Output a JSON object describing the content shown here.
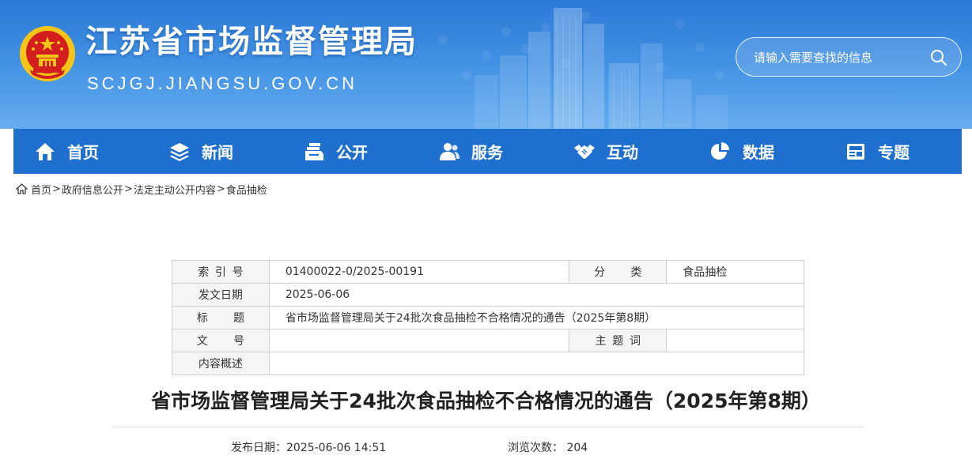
{
  "header": {
    "title": "江苏省市场监督管理局",
    "domain": "SCJGJ.JIANGSU.GOV.CN",
    "search_placeholder": "请输入需要查找的信息"
  },
  "nav": {
    "items": [
      {
        "label": "首页",
        "icon": "home-icon"
      },
      {
        "label": "新闻",
        "icon": "layers-icon"
      },
      {
        "label": "公开",
        "icon": "documents-icon"
      },
      {
        "label": "服务",
        "icon": "users-icon"
      },
      {
        "label": "互动",
        "icon": "handshake-icon"
      },
      {
        "label": "数据",
        "icon": "pie-chart-icon"
      },
      {
        "label": "专题",
        "icon": "newspaper-icon"
      }
    ]
  },
  "breadcrumb": {
    "items": [
      "首页",
      "政府信息公开",
      "法定主动公开内容",
      "食品抽检"
    ],
    "separator": ">"
  },
  "info": {
    "index_label": "索引号",
    "index_value": "01400022-0/2025-00191",
    "category_label": "分类",
    "category_value": "食品抽检",
    "date_label": "发文日期",
    "date_value": "2025-06-06",
    "title_label": "标题",
    "title_value": "省市场监督管理局关于24批次食品抽检不合格情况的通告（2025年第8期）",
    "docno_label": "文号",
    "docno_value": "",
    "keyword_label": "主题词",
    "keyword_value": "",
    "summary_label": "内容概述",
    "summary_value": ""
  },
  "article": {
    "title": "省市场监督管理局关于24批次食品抽检不合格情况的通告（2025年第8期）",
    "publish_label": "发布日期：",
    "publish_value": "2025-06-06 14:51",
    "views_label": "浏览次数：",
    "views_value": "204"
  },
  "colors": {
    "header_blue": "#2c79d6",
    "nav_blue": "#1e6fce",
    "emblem_red": "#d21e1e",
    "emblem_gold": "#f5c518"
  }
}
